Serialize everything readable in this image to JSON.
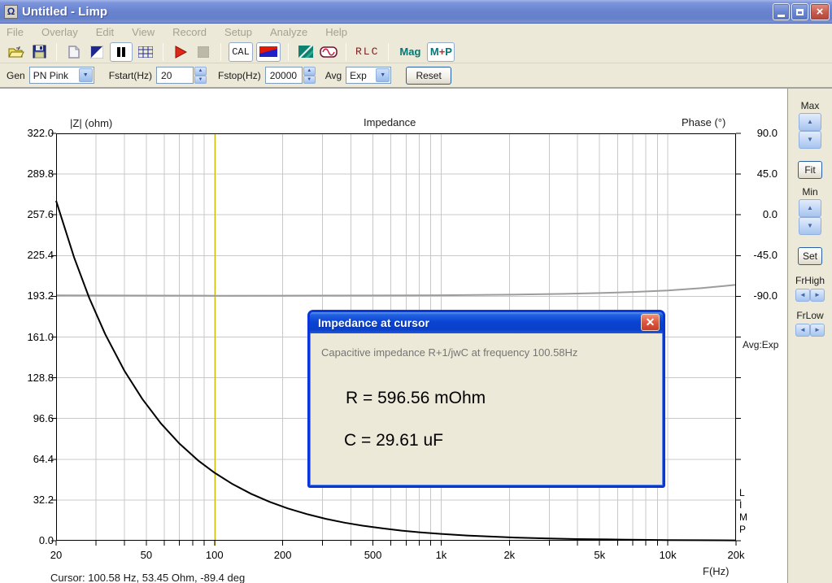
{
  "window": {
    "title": "Untitled - Limp",
    "app_icon_glyph": "Ω"
  },
  "menu": {
    "items": [
      "File",
      "Overlay",
      "Edit",
      "View",
      "Record",
      "Setup",
      "Analyze",
      "Help"
    ]
  },
  "toolbar": {
    "cal_label": "CAL",
    "rlc_label": "RLC",
    "mag_label": "Mag",
    "mp_parts": [
      "M",
      "+",
      "P"
    ]
  },
  "genbar": {
    "gen_label": "Gen",
    "gen_value": "PN Pink",
    "fstart_label": "Fstart(Hz)",
    "fstart_value": "20",
    "fstop_label": "Fstop(Hz)",
    "fstop_value": "20000",
    "avg_label": "Avg",
    "avg_value": "Exp",
    "reset_label": "Reset"
  },
  "side_panel": {
    "max_label": "Max",
    "fit_label": "Fit",
    "min_label": "Min",
    "set_label": "Set",
    "frhigh_label": "FrHigh",
    "frlow_label": "FrLow"
  },
  "overlays": {
    "avg_status": "Avg:Exp",
    "limp_vertical": [
      "L",
      "I",
      "M",
      "P"
    ]
  },
  "chart_data": {
    "type": "line",
    "title": "Impedance",
    "ylabel_left": "|Z| (ohm)",
    "ylabel_right": "Phase (°)",
    "xlabel": "F(Hz)",
    "x_scale": "log",
    "xlim": [
      20,
      20000
    ],
    "ylim_left": [
      0,
      322
    ],
    "ylim_right": [
      -90,
      90
    ],
    "grid": true,
    "left_ticks": [
      "322.0",
      "289.8",
      "257.6",
      "225.4",
      "193.2",
      "161.0",
      "128.8",
      "96.6",
      "64.4",
      "32.2",
      "0.0"
    ],
    "right_ticks": [
      "90.0",
      "45.0",
      "0.0",
      "-45.0",
      "-90.0"
    ],
    "x_ticks": [
      {
        "f": 20,
        "label": "20"
      },
      {
        "f": 50,
        "label": "50"
      },
      {
        "f": 100,
        "label": "100"
      },
      {
        "f": 200,
        "label": "200"
      },
      {
        "f": 500,
        "label": "500"
      },
      {
        "f": 1000,
        "label": "1k"
      },
      {
        "f": 2000,
        "label": "2k"
      },
      {
        "f": 5000,
        "label": "5k"
      },
      {
        "f": 10000,
        "label": "10k"
      },
      {
        "f": 20000,
        "label": "20k"
      }
    ],
    "x_minor_gridlines": [
      30,
      40,
      60,
      70,
      80,
      90,
      300,
      400,
      600,
      700,
      800,
      900,
      3000,
      4000,
      6000,
      7000,
      8000,
      9000
    ],
    "cursor_hz": 100.58,
    "cursor_color": "#C9B400",
    "series": [
      {
        "name": "Phase",
        "axis": "phase",
        "color": "#9C9C9C",
        "width": 2,
        "points": [
          [
            20,
            -89.0
          ],
          [
            50,
            -89.2
          ],
          [
            100,
            -89.4
          ],
          [
            200,
            -89.3
          ],
          [
            500,
            -89.1
          ],
          [
            1000,
            -88.8
          ],
          [
            2000,
            -88.2
          ],
          [
            3500,
            -87.3
          ],
          [
            5000,
            -86.4
          ],
          [
            7000,
            -85.2
          ],
          [
            10000,
            -83.5
          ],
          [
            14000,
            -81.0
          ],
          [
            20000,
            -77.3
          ]
        ]
      },
      {
        "name": "|Z|",
        "axis": "left",
        "color": "#000000",
        "width": 2,
        "points": [
          [
            20,
            268.7
          ],
          [
            24,
            223.9
          ],
          [
            28,
            191.9
          ],
          [
            33,
            162.9
          ],
          [
            40,
            134.4
          ],
          [
            48,
            112.0
          ],
          [
            58,
            92.7
          ],
          [
            70,
            76.8
          ],
          [
            85,
            63.2
          ],
          [
            100,
            53.7
          ],
          [
            120,
            44.8
          ],
          [
            145,
            37.1
          ],
          [
            175,
            30.7
          ],
          [
            210,
            25.6
          ],
          [
            255,
            21.1
          ],
          [
            310,
            17.3
          ],
          [
            375,
            14.3
          ],
          [
            450,
            11.9
          ],
          [
            550,
            9.8
          ],
          [
            670,
            8.0
          ],
          [
            800,
            6.7
          ],
          [
            1000,
            5.4
          ],
          [
            1300,
            4.1
          ],
          [
            1700,
            3.2
          ],
          [
            2200,
            2.4
          ],
          [
            3000,
            1.8
          ],
          [
            4000,
            1.3
          ],
          [
            5500,
            1.0
          ],
          [
            7500,
            0.72
          ],
          [
            10000,
            0.54
          ],
          [
            14000,
            0.38
          ],
          [
            20000,
            0.27
          ]
        ]
      }
    ]
  },
  "dialog": {
    "title": "Impedance at cursor",
    "message": "Capacitive impedance R+1/jwC at frequency 100.58Hz",
    "r_value": "R = 596.56 mOhm",
    "c_value": "C = 29.61 uF"
  },
  "status": {
    "cursor_text": "Cursor: 100.58 Hz, 53.45 Ohm, -89.4 deg"
  }
}
